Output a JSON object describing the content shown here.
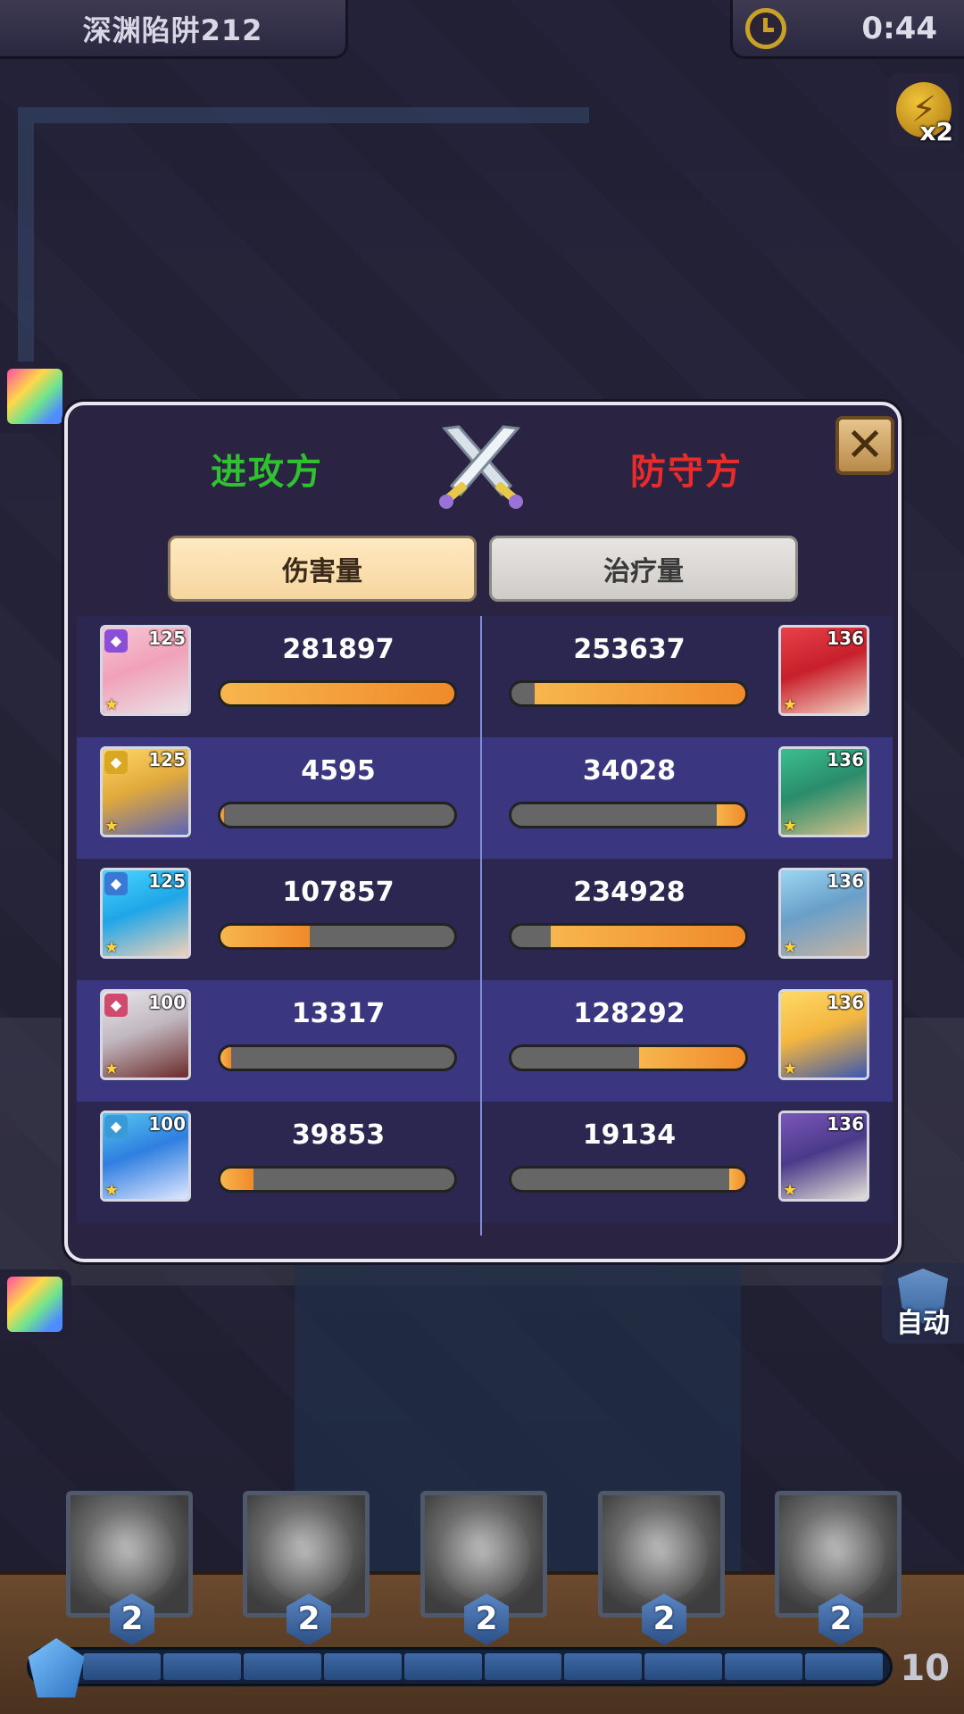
{
  "hud": {
    "stage_title": "深渊陷阱212",
    "timer": "0:44",
    "speed_multiplier": "x2",
    "auto_label": "自动",
    "icons": [
      "clock-icon",
      "lightning-icon",
      "shield-icon"
    ]
  },
  "panel": {
    "attacker_title": "进攻方",
    "defender_title": "防守方",
    "tabs": [
      {
        "label": "伤害量",
        "active": true
      },
      {
        "label": "治疗量",
        "active": false
      }
    ],
    "colors": {
      "attacker": "#2fc12f",
      "defender": "#e82b2b",
      "bar_fill": "#f59a36",
      "bar_track": "#666666"
    },
    "attackers": [
      {
        "level": "125",
        "class_color": "#8a4fd6",
        "value": "281897",
        "fill": 1.0
      },
      {
        "level": "125",
        "class_color": "#d8a823",
        "value": "4595",
        "fill": 0.016
      },
      {
        "level": "125",
        "class_color": "#3a78d6",
        "value": "107857",
        "fill": 0.383
      },
      {
        "level": "100",
        "class_color": "#d04a6e",
        "value": "13317",
        "fill": 0.047
      },
      {
        "level": "100",
        "class_color": "#3a9ad6",
        "value": "39853",
        "fill": 0.141
      }
    ],
    "defenders": [
      {
        "level": "136",
        "value": "253637",
        "fill": 0.9
      },
      {
        "level": "136",
        "value": "34028",
        "fill": 0.121
      },
      {
        "level": "136",
        "value": "234928",
        "fill": 0.833
      },
      {
        "level": "136",
        "value": "128292",
        "fill": 0.455
      },
      {
        "level": "136",
        "value": "19134",
        "fill": 0.068
      }
    ]
  },
  "skills": [
    {
      "cost": "2"
    },
    {
      "cost": "2"
    },
    {
      "cost": "2"
    },
    {
      "cost": "2"
    },
    {
      "cost": "2"
    }
  ],
  "energy": {
    "count": "10",
    "segments": 10
  }
}
